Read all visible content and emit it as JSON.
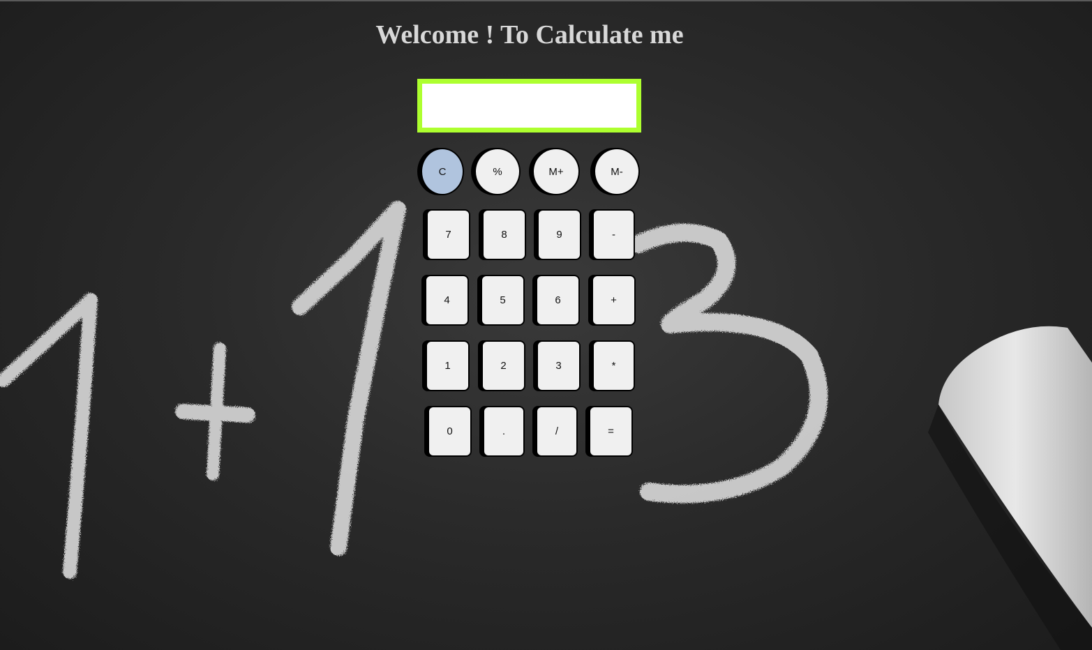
{
  "page": {
    "title": "Welcome ! To Calculate me"
  },
  "display": {
    "value": "",
    "placeholder": ""
  },
  "function_keys": [
    {
      "label": "C"
    },
    {
      "label": "%"
    },
    {
      "label": "M+"
    },
    {
      "label": "M-"
    }
  ],
  "keypad": {
    "row1": [
      "7",
      "8",
      "9",
      "-"
    ],
    "row2": [
      "4",
      "5",
      "6",
      "+"
    ],
    "row3": [
      "1",
      "2",
      "3",
      "*"
    ],
    "row4": [
      "0",
      ".",
      "/",
      "="
    ]
  },
  "colors": {
    "display_border": "#adff2f",
    "clear_button": "#b0c4de",
    "key_face": "#f0f0f0"
  },
  "background": {
    "icon": "chalkboard-with-chalk-writing"
  }
}
